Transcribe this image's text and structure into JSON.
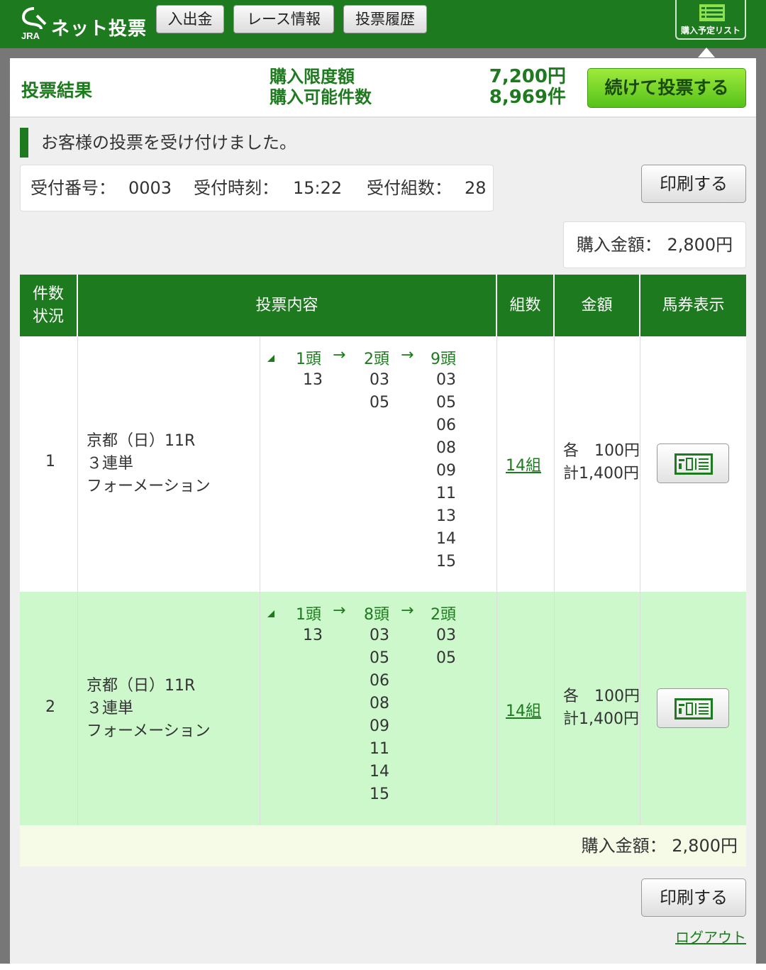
{
  "header": {
    "brand": "ネット投票",
    "brand_sub": "JRA",
    "nav": [
      "入出金",
      "レース情報",
      "投票履歴"
    ],
    "plan_list_label": "購入予定リスト"
  },
  "result": {
    "title": "投票結果",
    "limit_amount_label": "購入限度額",
    "limit_count_label": "購入可能件数",
    "limit_amount": "7,200円",
    "limit_count": "8,969件",
    "continue_label": "続けて投票する"
  },
  "notice": "お客様の投票を受け付けました。",
  "receipt": {
    "number_label": "受付番号：",
    "number": "0003",
    "time_label": "受付時刻：",
    "time": "15:22",
    "count_label": "受付組数：",
    "count": "28"
  },
  "print_label": "印刷する",
  "purchase": {
    "label": "購入金額：",
    "amount": "2,800円"
  },
  "table": {
    "col_count_status": [
      "件数",
      "状況"
    ],
    "col_content": "投票内容",
    "col_kumi": "組数",
    "col_amount": "金額",
    "col_ticket": "馬券表示"
  },
  "rows": [
    {
      "num": "1",
      "race": [
        "京都（日）11R",
        "３連単",
        "フォーメーション"
      ],
      "heads": [
        "1頭",
        "2頭",
        "9頭"
      ],
      "arrow": "→",
      "col1": [
        "13"
      ],
      "col2": [
        "03",
        "05"
      ],
      "col3": [
        "03",
        "05",
        "06",
        "08",
        "09",
        "11",
        "13",
        "14",
        "15"
      ],
      "kumi": "14組",
      "each": "各　100円",
      "total": "計1,400円"
    },
    {
      "num": "2",
      "race": [
        "京都（日）11R",
        "３連単",
        "フォーメーション"
      ],
      "heads": [
        "1頭",
        "8頭",
        "2頭"
      ],
      "arrow": "→",
      "col1": [
        "13"
      ],
      "col2": [
        "03",
        "05",
        "06",
        "08",
        "09",
        "11",
        "14",
        "15"
      ],
      "col3": [
        "03",
        "05"
      ],
      "kumi": "14組",
      "each": "各　100円",
      "total": "計1,400円"
    }
  ],
  "logout_label": "ログアウト",
  "colors": {
    "brand_green": "#1e7a1e",
    "continue_green": "#7ed62c",
    "row_alt": "#ccf8cc"
  },
  "icons": [
    "jra-logo-icon",
    "list-icon",
    "ticket-icon",
    "triangle-icon"
  ]
}
